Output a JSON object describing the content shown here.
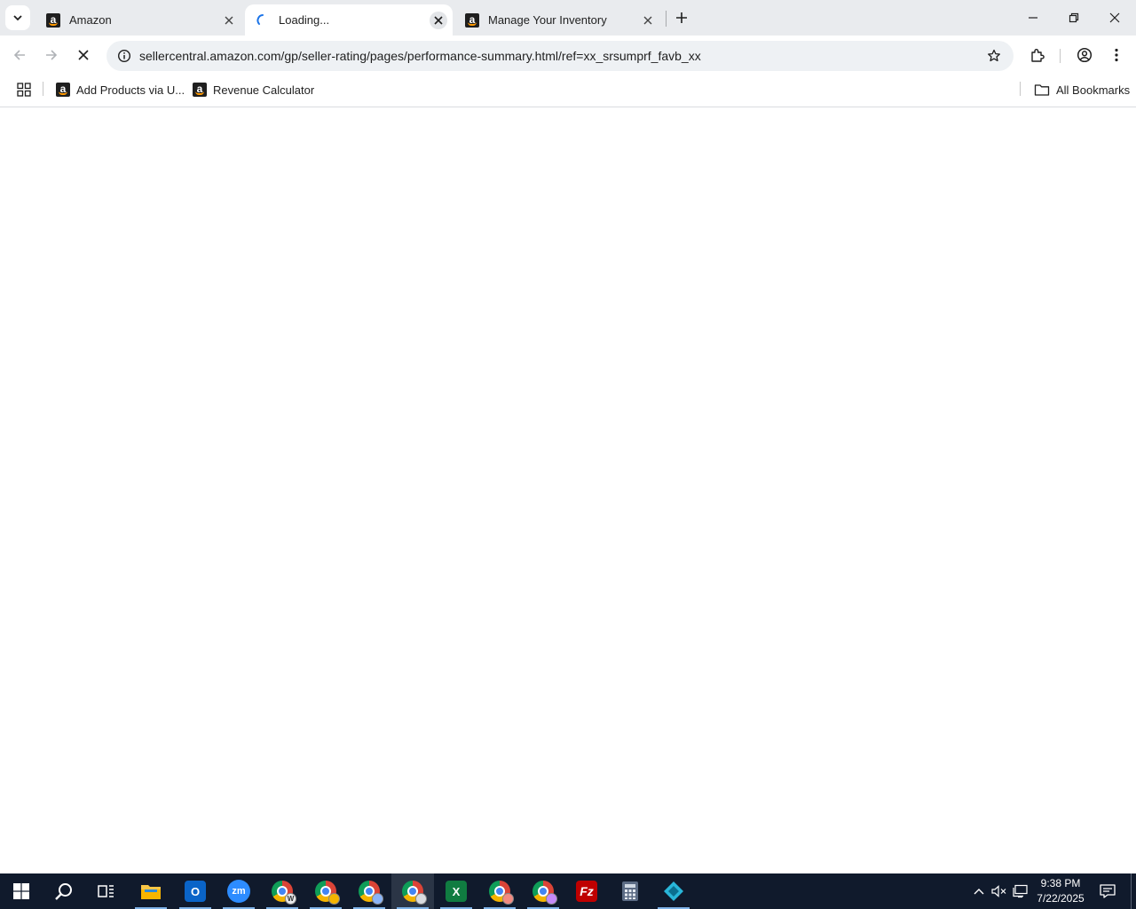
{
  "browser": {
    "tabs": [
      {
        "title": "Amazon",
        "favicon": "amazon-icon",
        "active": false
      },
      {
        "title": "Loading...",
        "favicon": "loading-spinner-icon",
        "active": true
      },
      {
        "title": "Manage Your Inventory",
        "favicon": "amazon-icon",
        "active": false
      }
    ],
    "address": {
      "url": "sellercentral.amazon.com/gp/seller-rating/pages/performance-summary.html/ref=xx_srsumprf_favb_xx"
    },
    "bookmarks": [
      {
        "label": "Add Products via U...",
        "favicon": "amazon-icon"
      },
      {
        "label": "Revenue Calculator",
        "favicon": "amazon-icon"
      }
    ],
    "all_bookmarks_label": "All Bookmarks"
  },
  "taskbar": {
    "apps": [
      "file-explorer",
      "outlook",
      "zoom",
      "chrome-profile-w",
      "chrome-profile-2",
      "chrome-profile-3",
      "chrome-profile-4",
      "excel",
      "chrome-profile-5",
      "chrome-profile-6",
      "filezilla",
      "calculator",
      "app-diamond"
    ],
    "clock": {
      "time": "9:38 PM",
      "date": "7/22/2025"
    }
  },
  "colors": {
    "tabstrip_bg": "#e9ebee",
    "omnibox_bg": "#eef1f4",
    "taskbar_bg": "#101a2c",
    "amazon_orange": "#ff9900"
  }
}
